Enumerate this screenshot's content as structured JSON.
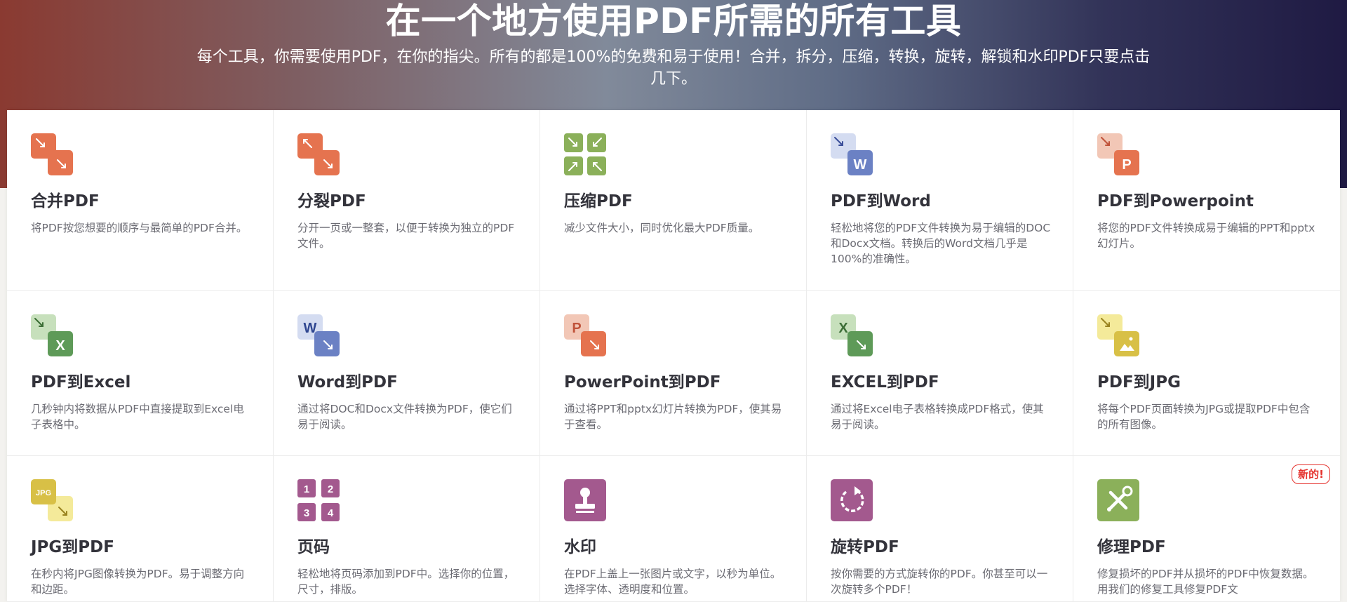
{
  "header": {
    "title": "在一个地方使用PDF所需的所有工具",
    "subtitle": "每个工具，你需要使用PDF，在你的指尖。所有的都是100%的免费和易于使用！合并，拆分，压缩，转换，旋转，解锁和水印PDF只要点击几下。"
  },
  "tools": [
    {
      "icon": "merge-pdf-icon",
      "title": "合并PDF",
      "desc": "将PDF按您想要的顺序与最简单的PDF合并。"
    },
    {
      "icon": "split-pdf-icon",
      "title": "分裂PDF",
      "desc": "分开一页或一整套，以便于转换为独立的PDF文件。"
    },
    {
      "icon": "compress-pdf-icon",
      "title": "压缩PDF",
      "desc": "减少文件大小，同时优化最大PDF质量。"
    },
    {
      "icon": "pdf-to-word-icon",
      "title": "PDF到Word",
      "desc": "轻松地将您的PDF文件转换为易于编辑的DOC和Docx文档。转换后的Word文档几乎是100%的准确性。"
    },
    {
      "icon": "pdf-to-powerpoint-icon",
      "title": "PDF到Powerpoint",
      "desc": "将您的PDF文件转换成易于编辑的PPT和pptx幻灯片。"
    },
    {
      "icon": "pdf-to-excel-icon",
      "title": "PDF到Excel",
      "desc": "几秒钟内将数据从PDF中直接提取到Excel电子表格中。"
    },
    {
      "icon": "word-to-pdf-icon",
      "title": "Word到PDF",
      "desc": "通过将DOC和Docx文件转换为PDF，使它们易于阅读。"
    },
    {
      "icon": "powerpoint-to-pdf-icon",
      "title": "PowerPoint到PDF",
      "desc": "通过将PPT和pptx幻灯片转换为PDF，使其易于查看。"
    },
    {
      "icon": "excel-to-pdf-icon",
      "title": "EXCEL到PDF",
      "desc": "通过将Excel电子表格转换成PDF格式，使其易于阅读。"
    },
    {
      "icon": "pdf-to-jpg-icon",
      "title": "PDF到JPG",
      "desc": "将每个PDF页面转换为JPG或提取PDF中包含的所有图像。"
    },
    {
      "icon": "jpg-to-pdf-icon",
      "title": "JPG到PDF",
      "desc": "在秒内将JPG图像转换为PDF。易于调整方向和边距。"
    },
    {
      "icon": "page-numbers-icon",
      "title": "页码",
      "desc": "轻松地将页码添加到PDF中。选择你的位置，尺寸，排版。"
    },
    {
      "icon": "watermark-stamp-icon",
      "title": "水印",
      "desc": "在PDF上盖上一张图片或文字，以秒为单位。选择字体、透明度和位置。"
    },
    {
      "icon": "rotate-pdf-icon",
      "title": "旋转PDF",
      "desc": "按你需要的方式旋转你的PDF。你甚至可以一次旋转多个PDF！"
    },
    {
      "icon": "repair-pdf-icon",
      "title": "修理PDF",
      "desc": "修复损坏的PDF并从损坏的PDF中恢复数据。用我们的修复工具修复PDF文",
      "badge": "新的!"
    }
  ],
  "icon_glyphs": {
    "word": "W",
    "powerpoint": "P",
    "excel": "X",
    "jpg": "JPG",
    "page_numbers": [
      "1",
      "2",
      "3",
      "4"
    ]
  },
  "colors": {
    "orange": "#e5734f",
    "light_orange": "#f2c7b6",
    "green": "#8bb05a",
    "blue": "#6b81c4",
    "light_blue": "#d4dcf1",
    "dark_green": "#5e9a58",
    "light_green": "#c7e0bc",
    "yellow": "#d8c046",
    "light_yellow": "#f4ea9a",
    "purple": "#a3598e"
  }
}
